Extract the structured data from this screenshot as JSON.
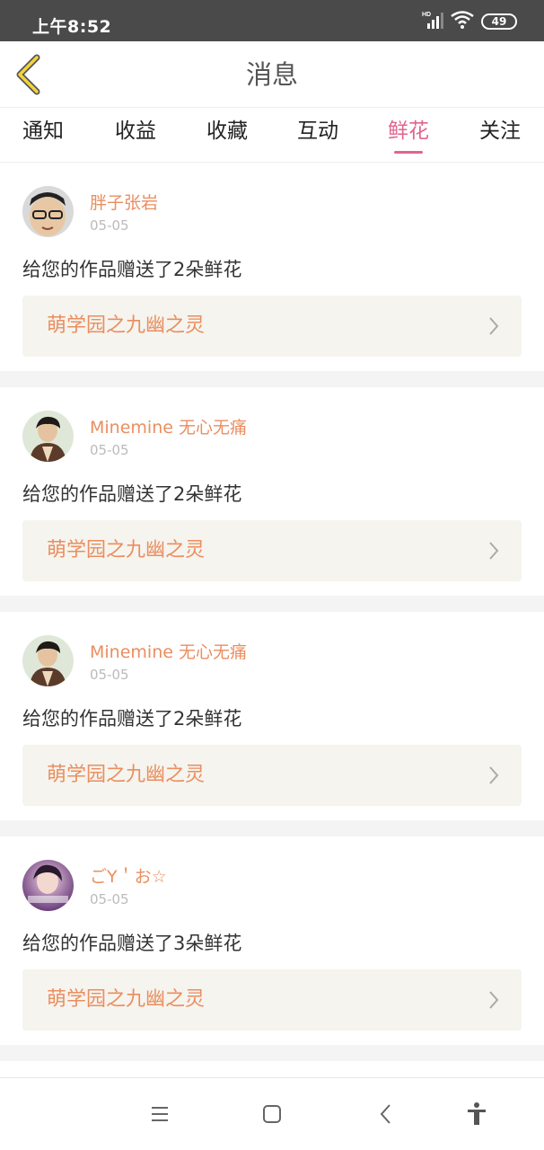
{
  "status_bar": {
    "time": "上午8:52",
    "battery": "49",
    "network_label": "HD"
  },
  "header": {
    "title": "消息",
    "back_icon": "chevron-left-icon"
  },
  "tabs": [
    {
      "label": "通知",
      "active": false
    },
    {
      "label": "收益",
      "active": false
    },
    {
      "label": "收藏",
      "active": false
    },
    {
      "label": "互动",
      "active": false
    },
    {
      "label": "鲜花",
      "active": true
    },
    {
      "label": "关注",
      "active": false
    }
  ],
  "colors": {
    "accent": "#e0658f",
    "username": "#ea8e60",
    "work_bg": "#f5f4ee"
  },
  "notifications": [
    {
      "username": "胖子张岩",
      "date": "05-05",
      "message": "给您的作品赠送了2朵鲜花",
      "work_title": "萌学园之九幽之灵"
    },
    {
      "username": "Minemine 无心无痛",
      "date": "05-05",
      "message": "给您的作品赠送了2朵鲜花",
      "work_title": "萌学园之九幽之灵"
    },
    {
      "username": "Minemine 无心无痛",
      "date": "05-05",
      "message": "给您的作品赠送了2朵鲜花",
      "work_title": "萌学园之九幽之灵"
    },
    {
      "username": "ごY＇お☆",
      "date": "05-05",
      "message": "给您的作品赠送了3朵鲜花",
      "work_title": "萌学园之九幽之灵"
    }
  ],
  "system_nav": [
    "menu-icon",
    "home-icon",
    "back-icon",
    "accessibility-icon"
  ]
}
